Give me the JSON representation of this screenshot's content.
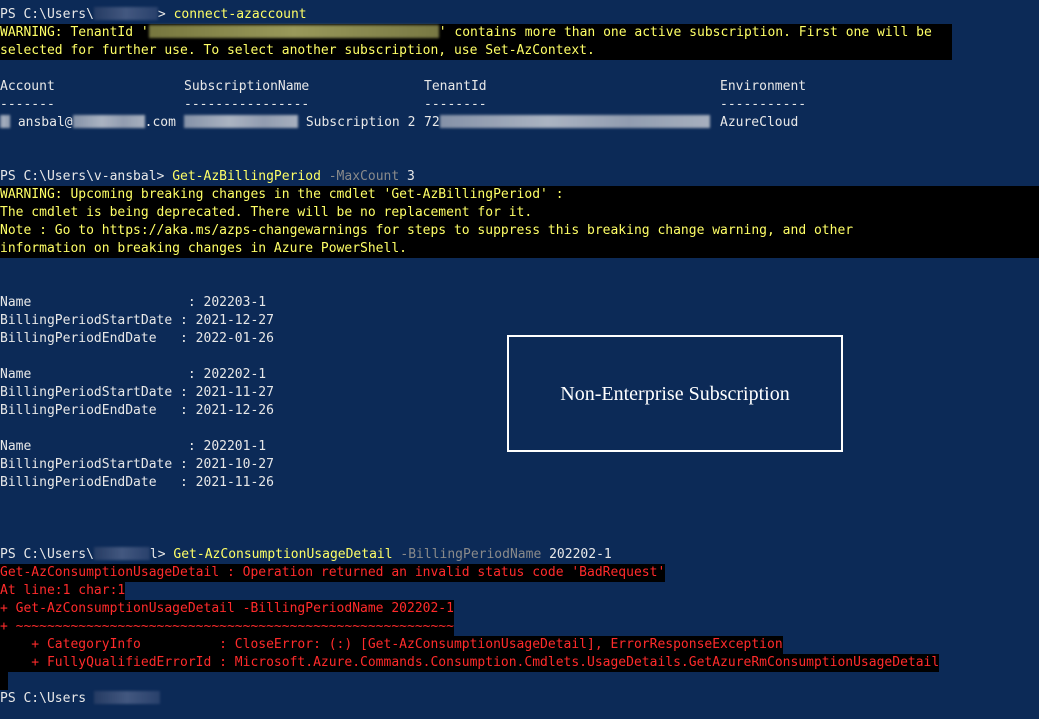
{
  "prompt_prefix": "PS C:\\Users\\",
  "prompt_suffix": "> ",
  "command1": "connect-azaccount",
  "warning1_start": "WARNING: TenantId '",
  "warning1_end": "' contains more than one active subscription. First one will be",
  "warning1_line2": "selected for further use. To select another subscription, use Set-AzContext.",
  "account_table": {
    "headers": [
      "Account",
      "SubscriptionName",
      "TenantId",
      "Environment"
    ],
    "dashes": [
      "-------",
      "----------------",
      "--------",
      "-----------"
    ],
    "row": {
      "account_prefix": "ansbal@",
      "account_suffix": ".com",
      "subscription": "Subscription 2",
      "tenant_prefix": "72",
      "environment": "AzureCloud"
    }
  },
  "prompt2": "PS C:\\Users\\v-ansbal> ",
  "command2": "Get-AzBillingPeriod",
  "command2_param": "-MaxCount",
  "command2_arg": "3",
  "warning2": [
    "WARNING: Upcoming breaking changes in the cmdlet 'Get-AzBillingPeriod' :",
    "The cmdlet is being deprecated. There will be no replacement for it.",
    "Note : Go to https://aka.ms/azps-changewarnings for steps to suppress this breaking change warning, and other",
    "information on breaking changes in Azure PowerShell."
  ],
  "billing_periods": [
    {
      "name_label": "Name                    : 202203-1",
      "start_label": "BillingPeriodStartDate : 2021-12-27",
      "end_label": "BillingPeriodEndDate   : 2022-01-26"
    },
    {
      "name_label": "Name                    : 202202-1",
      "start_label": "BillingPeriodStartDate : 2021-11-27",
      "end_label": "BillingPeriodEndDate   : 2021-12-26"
    },
    {
      "name_label": "Name                    : 202201-1",
      "start_label": "BillingPeriodStartDate : 2021-10-27",
      "end_label": "BillingPeriodEndDate   : 2021-11-26"
    }
  ],
  "annotation": "Non-Enterprise Subscription",
  "prompt3_suffix": "l> ",
  "command3": "Get-AzConsumptionUsageDetail",
  "command3_param": "-BillingPeriodName",
  "command3_arg": "202202-1",
  "errors": [
    "Get-AzConsumptionUsageDetail : Operation returned an invalid status code 'BadRequest'",
    "At line:1 char:1",
    "+ Get-AzConsumptionUsageDetail -BillingPeriodName 202202-1",
    "+ ~~~~~~~~~~~~~~~~~~~~~~~~~~~~~~~~~~~~~~~~~~~~~~~~~~~~~~~~",
    "    + CategoryInfo          : CloseError: (:) [Get-AzConsumptionUsageDetail], ErrorResponseException",
    "    + FullyQualifiedErrorId : Microsoft.Azure.Commands.Consumption.Cmdlets.UsageDetails.GetAzureRmConsumptionUsageDetail",
    " "
  ],
  "prompt4_prefix": "PS C:\\Users"
}
